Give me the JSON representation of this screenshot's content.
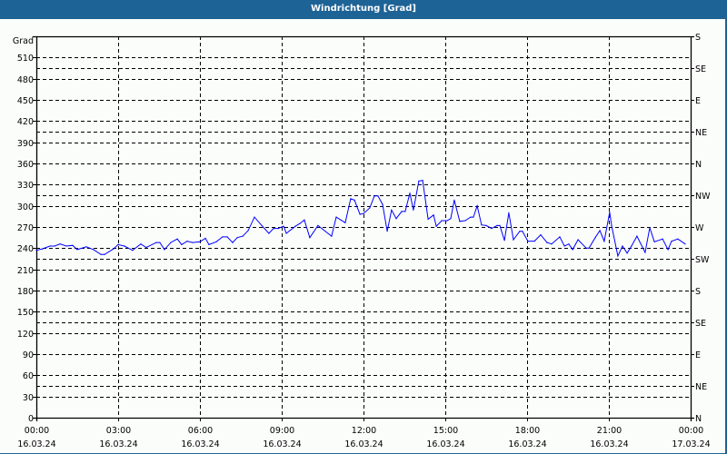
{
  "title": "Windrichtung [Grad]",
  "chart_data": {
    "type": "line",
    "title": "Windrichtung [Grad]",
    "ylabel": "Grad",
    "ylim": [
      0,
      540
    ],
    "xlim": [
      0,
      24
    ],
    "grid": true,
    "y_ticks": [
      0,
      30,
      60,
      90,
      120,
      150,
      180,
      210,
      240,
      270,
      300,
      330,
      360,
      390,
      420,
      450,
      480,
      510
    ],
    "right_axis": {
      "ticks": [
        0,
        45,
        90,
        135,
        180,
        225,
        270,
        315,
        360,
        405,
        450,
        495,
        540
      ],
      "labels": [
        "N",
        "NE",
        "E",
        "SE",
        "S",
        "SW",
        "W",
        "NW",
        "N",
        "NE",
        "E",
        "SE",
        "S"
      ]
    },
    "x_ticks": [
      {
        "h": 0,
        "time": "00:00",
        "date": "16.03.24"
      },
      {
        "h": 3,
        "time": "03:00",
        "date": "16.03.24"
      },
      {
        "h": 6,
        "time": "06:00",
        "date": "16.03.24"
      },
      {
        "h": 9,
        "time": "09:00",
        "date": "16.03.24"
      },
      {
        "h": 12,
        "time": "12:00",
        "date": "16.03.24"
      },
      {
        "h": 15,
        "time": "15:00",
        "date": "16.03.24"
      },
      {
        "h": 18,
        "time": "18:00",
        "date": "16.03.24"
      },
      {
        "h": 21,
        "time": "21:00",
        "date": "16.03.24"
      },
      {
        "h": 24,
        "time": "00:00",
        "date": "17.03.24"
      }
    ],
    "line_color": "#0000ff",
    "series": [
      {
        "name": "Windrichtung",
        "x": [
          0,
          0.22,
          0.5,
          0.67,
          0.87,
          1.1,
          1.33,
          1.5,
          1.83,
          2.1,
          2.37,
          2.5,
          2.83,
          3,
          3.23,
          3.53,
          3.83,
          4.03,
          4.4,
          4.53,
          4.7,
          4.93,
          5.17,
          5.33,
          5.53,
          5.73,
          6,
          6.2,
          6.33,
          6.6,
          6.83,
          7,
          7.2,
          7.37,
          7.57,
          7.77,
          8,
          8.27,
          8.53,
          8.7,
          8.87,
          9.07,
          9.17,
          9.5,
          9.67,
          9.83,
          10.03,
          10.33,
          10.83,
          11,
          11.33,
          11.53,
          11.67,
          11.87,
          12,
          12.23,
          12.4,
          12.53,
          12.7,
          12.87,
          13.03,
          13.2,
          13.4,
          13.53,
          13.7,
          13.83,
          14.03,
          14.17,
          14.37,
          14.57,
          14.67,
          14.87,
          15.07,
          15.2,
          15.33,
          15.53,
          15.73,
          15.93,
          16.03,
          16.17,
          16.33,
          16.5,
          16.7,
          16.9,
          17,
          17.17,
          17.33,
          17.5,
          17.73,
          17.83,
          18.03,
          18.27,
          18.5,
          18.73,
          18.9,
          19.2,
          19.37,
          19.53,
          19.67,
          19.87,
          20.17,
          20.27,
          20.5,
          20.67,
          20.83,
          21.03,
          21.1,
          21.33,
          21.5,
          21.67,
          21.83,
          22.03,
          22.33,
          22.5,
          22.67,
          22.97,
          23.17,
          23.3,
          23.53,
          23.8
        ],
        "y": [
          237,
          239,
          243,
          243,
          246,
          243,
          244,
          238,
          242,
          238,
          231,
          231,
          239,
          245,
          243,
          237,
          246,
          241,
          248,
          248,
          238,
          248,
          253,
          245,
          250,
          248,
          249,
          254,
          245,
          249,
          256,
          256,
          248,
          255,
          257,
          265,
          284,
          272,
          261,
          268,
          268,
          271,
          261,
          271,
          275,
          280,
          255,
          272,
          257,
          284,
          276,
          310,
          308,
          288,
          289,
          297,
          314,
          314,
          302,
          264,
          294,
          282,
          292,
          292,
          318,
          294,
          335,
          336,
          281,
          287,
          271,
          279,
          279,
          282,
          308,
          278,
          279,
          284,
          284,
          300,
          273,
          272,
          268,
          272,
          272,
          251,
          290,
          252,
          264,
          264,
          250,
          250,
          259,
          248,
          246,
          256,
          243,
          246,
          238,
          252,
          240,
          240,
          255,
          265,
          250,
          291,
          272,
          229,
          243,
          233,
          243,
          257,
          234,
          269,
          249,
          253,
          238,
          250,
          253,
          246
        ]
      }
    ]
  }
}
